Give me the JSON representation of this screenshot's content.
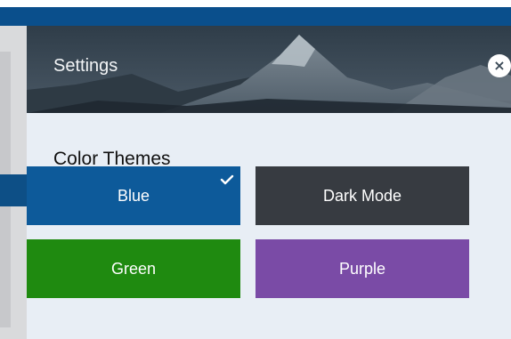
{
  "settings": {
    "title": "Settings",
    "close_symbol": "×",
    "section_title": "Color Themes",
    "themes": [
      {
        "label": "Blue",
        "color": "#0d5a9a",
        "selected": true
      },
      {
        "label": "Dark Mode",
        "color": "#373b41",
        "selected": false
      },
      {
        "label": "Green",
        "color": "#1f8a10",
        "selected": false
      },
      {
        "label": "Purple",
        "color": "#7a4ba6",
        "selected": false
      }
    ]
  },
  "icons": {
    "close": "close-icon",
    "check": "check-icon"
  },
  "colors": {
    "header": "#3b4a57",
    "panel": "#e8eef5",
    "app_topbar": "#0a4f8c"
  }
}
